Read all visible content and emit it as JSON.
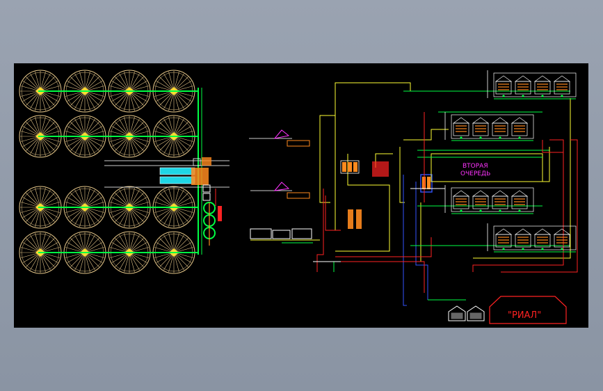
{
  "drawing": {
    "labels": {
      "second_stage_line1": "ВТОРАЯ",
      "second_stage_line2": "ОЧЕРЕДЬ",
      "company_stamp": "\"РИАЛ\""
    },
    "colors": {
      "background": "#000000",
      "frame": "#8d97a6",
      "silo": "#e8c98a",
      "conveyor_green": "#00ff44",
      "yellow": "#ffff33",
      "magenta": "#ff33ff",
      "red": "#ff2222",
      "blue": "#3355ff",
      "white": "#ffffff",
      "cyan": "#33ffff",
      "orange": "#ff8a1e"
    }
  }
}
